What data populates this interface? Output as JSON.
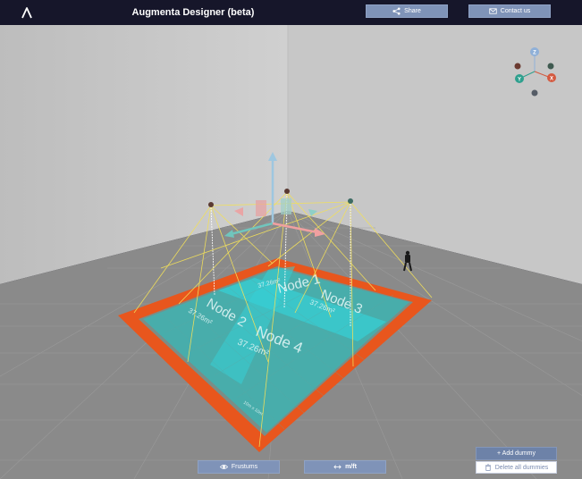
{
  "header": {
    "title": "Augmenta Designer (beta)",
    "share_label": "Share",
    "contact_label": "Contact us"
  },
  "scene": {
    "nodes": [
      {
        "name": "Node 1",
        "area": "37.26m²"
      },
      {
        "name": "Node 2",
        "area": "37.26m²"
      },
      {
        "name": "Node 3",
        "area": "37.26m²"
      },
      {
        "name": "Node 4",
        "area": "37.26m²"
      }
    ],
    "dimension_label": "10m x 10m",
    "gizmo": {
      "x": "X",
      "y": "Y",
      "z": "Z"
    }
  },
  "toolbar": {
    "frustums_label": "Frustums",
    "units_label": "m/ft",
    "add_dummy_label": "+ Add dummy",
    "delete_dummies_label": "Delete all dummies"
  },
  "colors": {
    "header_bg": "#16162a",
    "button_bg": "#7f93b8",
    "floor_border": "#e8561d",
    "coverage": "#3fc4c4",
    "frustum_lines": "#f2e05a"
  }
}
